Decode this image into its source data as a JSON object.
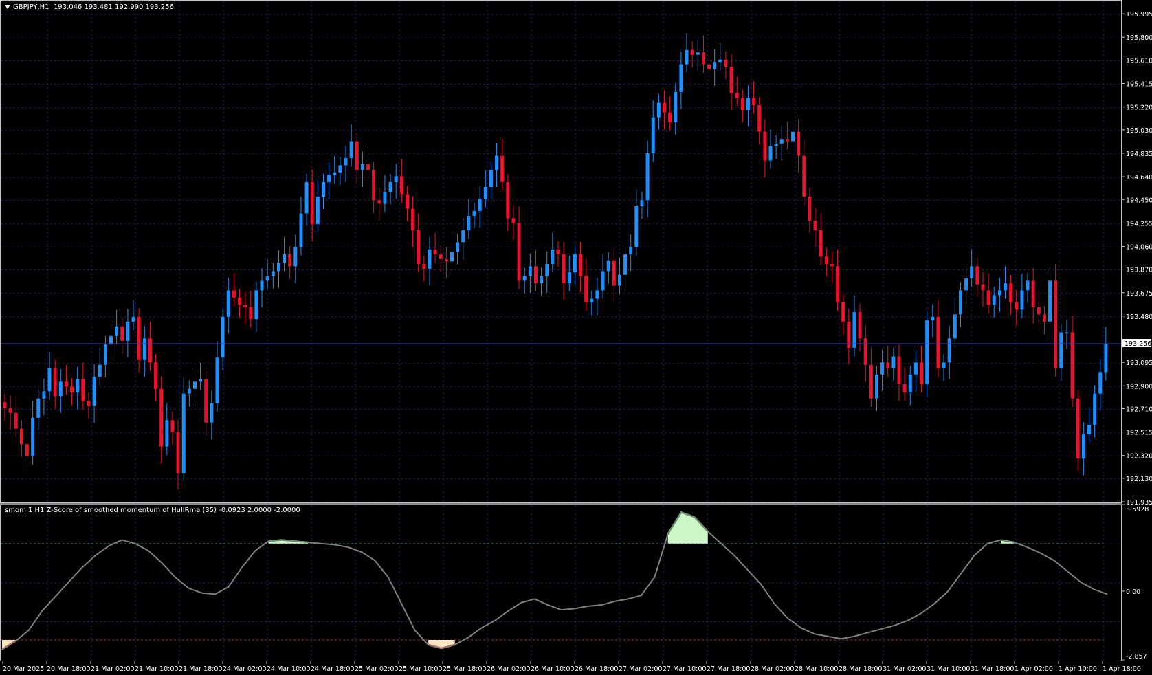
{
  "chart_header": {
    "symbol_tf": "GBPJPY,H1",
    "ohlc": "193.046 193.481 192.990 193.256"
  },
  "indicator_header": {
    "label": "smom 1 H1 Z-Score of smoothed momentum of HullRma (35) -0.0923 2.0000 -2.0000"
  },
  "current_price_label": "193.256",
  "colors": {
    "bull": "#1e90ff",
    "bear": "#e8132c",
    "grid": "#1d1d6b",
    "line": "#808080",
    "upper_fill": "#ccf5c8",
    "upper_edge": "#32cd32",
    "lower_fill": "#fce3c0",
    "lower_edge": "#ff0000"
  },
  "chart_data": [
    {
      "type": "candlestick",
      "symbol": "GBPJPY",
      "timeframe": "H1",
      "ylim": [
        191.935,
        196.11
      ],
      "price_ticks": [
        "195.995",
        "195.800",
        "195.610",
        "195.415",
        "195.220",
        "195.030",
        "194.835",
        "194.640",
        "194.450",
        "194.255",
        "194.060",
        "193.870",
        "193.675",
        "193.480",
        "193.095",
        "192.900",
        "192.710",
        "192.515",
        "192.320",
        "192.130",
        "191.935"
      ],
      "current_price": 193.256,
      "time_labels": [
        "20 Mar 2025",
        "20 Mar 18:00",
        "21 Mar 02:00",
        "21 Mar 10:00",
        "21 Mar 18:00",
        "24 Mar 02:00",
        "24 Mar 10:00",
        "24 Mar 18:00",
        "25 Mar 02:00",
        "25 Mar 10:00",
        "25 Mar 18:00",
        "26 Mar 02:00",
        "26 Mar 10:00",
        "26 Mar 18:00",
        "27 Mar 02:00",
        "27 Mar 10:00",
        "27 Mar 18:00",
        "28 Mar 02:00",
        "28 Mar 10:00",
        "28 Mar 18:00",
        "31 Mar 02:00",
        "31 Mar 10:00",
        "31 Mar 18:00",
        "1 Apr 02:00",
        "1 Apr 10:00",
        "1 Apr 18:00"
      ],
      "closes": [
        192.72,
        192.68,
        192.55,
        192.42,
        192.32,
        192.64,
        192.8,
        192.86,
        193.05,
        192.82,
        192.94,
        192.9,
        192.85,
        192.96,
        192.78,
        192.74,
        192.98,
        193.08,
        193.25,
        193.32,
        193.4,
        193.28,
        193.44,
        193.48,
        193.12,
        193.3,
        193.1,
        192.88,
        192.4,
        192.62,
        192.52,
        192.18,
        192.84,
        192.88,
        192.94,
        192.96,
        192.6,
        192.76,
        193.14,
        193.48,
        193.7,
        193.64,
        193.58,
        193.56,
        193.46,
        193.7,
        193.78,
        193.82,
        193.86,
        193.93,
        194.0,
        193.9,
        194.06,
        194.34,
        194.6,
        194.25,
        194.48,
        194.6,
        194.66,
        194.68,
        194.74,
        194.8,
        194.94,
        194.7,
        194.75,
        194.7,
        194.45,
        194.42,
        194.52,
        194.6,
        194.65,
        194.5,
        194.38,
        194.2,
        193.92,
        193.88,
        194.04,
        194.0,
        193.96,
        193.94,
        194.02,
        194.1,
        194.2,
        194.32,
        194.36,
        194.46,
        194.56,
        194.7,
        194.82,
        194.6,
        194.3,
        194.26,
        193.78,
        193.82,
        193.9,
        193.76,
        193.82,
        193.92,
        194.04,
        194.0,
        193.76,
        193.85,
        194.0,
        193.82,
        193.6,
        193.63,
        193.7,
        193.86,
        193.95,
        193.74,
        193.83,
        194.0,
        194.06,
        194.4,
        194.45,
        194.84,
        195.14,
        195.26,
        195.18,
        195.1,
        195.35,
        195.58,
        195.7,
        195.66,
        195.68,
        195.58,
        195.54,
        195.6,
        195.62,
        195.56,
        195.34,
        195.3,
        195.2,
        195.3,
        195.24,
        195.02,
        194.78,
        194.9,
        194.92,
        194.96,
        194.94,
        195.02,
        194.82,
        194.48,
        194.28,
        194.2,
        193.98,
        193.92,
        193.9,
        193.6,
        193.44,
        193.22,
        193.52,
        193.3,
        193.08,
        192.8,
        193.0,
        193.1,
        193.05,
        193.15,
        192.92,
        192.85,
        193.0,
        193.1,
        192.92,
        193.45,
        193.48,
        193.05,
        193.1,
        193.3,
        193.5,
        193.7,
        193.8,
        193.9,
        193.75,
        193.7,
        193.58,
        193.66,
        193.7,
        193.76,
        193.6,
        193.54,
        193.7,
        193.78,
        193.56,
        193.5,
        193.44,
        193.78,
        193.05,
        193.35,
        193.35,
        192.8,
        192.3,
        192.5,
        192.58,
        192.84,
        193.02,
        193.256
      ],
      "panels": [
        {
          "type": "line",
          "name": "smom 1 H1 Z-Score of smoothed momentum of HullRma (35)",
          "ylim": [
            -2.857,
            3.5928
          ],
          "y_ticks": [
            "3.5928",
            "0.00",
            "-2.857"
          ],
          "levels": [
            2.0,
            -2.0
          ],
          "readout": [
            -0.0923,
            2.0,
            -2.0
          ],
          "values": [
            -2.4,
            -2.05,
            -1.6,
            -0.8,
            -0.2,
            0.4,
            1.0,
            1.5,
            1.9,
            2.15,
            2.0,
            1.7,
            1.2,
            0.6,
            0.15,
            -0.05,
            -0.1,
            0.2,
            1.0,
            1.7,
            2.1,
            2.15,
            2.1,
            2.05,
            2.0,
            1.95,
            1.85,
            1.65,
            1.3,
            0.6,
            -0.5,
            -1.6,
            -2.2,
            -2.35,
            -2.2,
            -1.9,
            -1.5,
            -1.2,
            -0.8,
            -0.45,
            -0.3,
            -0.55,
            -0.75,
            -0.7,
            -0.6,
            -0.55,
            -0.4,
            -0.3,
            -0.15,
            0.6,
            2.4,
            3.3,
            3.1,
            2.5,
            2.0,
            1.5,
            0.9,
            0.3,
            -0.5,
            -1.1,
            -1.5,
            -1.75,
            -1.85,
            -1.95,
            -1.85,
            -1.7,
            -1.55,
            -1.4,
            -1.2,
            -0.9,
            -0.5,
            0.0,
            0.75,
            1.5,
            2.0,
            2.15,
            2.05,
            1.85,
            1.6,
            1.3,
            0.85,
            0.4,
            0.1,
            -0.1
          ]
        }
      ]
    }
  ]
}
